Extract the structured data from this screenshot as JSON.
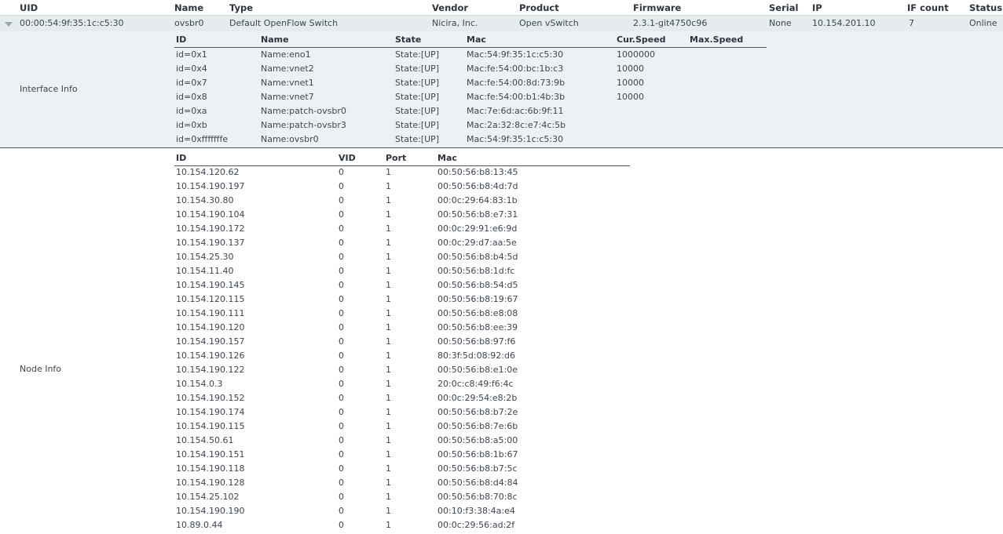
{
  "columns": {
    "uid": "UID",
    "name": "Name",
    "type": "Type",
    "vendor": "Vendor",
    "product": "Product",
    "firmware": "Firmware",
    "serial": "Serial",
    "ip": "IP",
    "ifcount": "IF count",
    "status": "Status"
  },
  "device": {
    "uid": "00:00:54:9f:35:1c:c5:30",
    "name": "ovsbr0",
    "type": "Default OpenFlow Switch",
    "vendor": "Nicira, Inc.",
    "product": "Open vSwitch",
    "firmware": "2.3.1-git4750c96",
    "serial": "None",
    "ip": "10.154.201.10",
    "ifcount": "7",
    "status": "Online"
  },
  "interface_info": {
    "label": "Interface Info",
    "headers": {
      "id": "ID",
      "name": "Name",
      "state": "State",
      "mac": "Mac",
      "cur_speed": "Cur.Speed",
      "max_speed": "Max.Speed"
    },
    "rows": [
      {
        "id": "id=0x1",
        "name": "Name:eno1",
        "state": "State:[UP]",
        "mac": "Mac:54:9f:35:1c:c5:30",
        "cur_speed": "1000000",
        "max_speed": ""
      },
      {
        "id": "id=0x4",
        "name": "Name:vnet2",
        "state": "State:[UP]",
        "mac": "Mac:fe:54:00:bc:1b:c3",
        "cur_speed": "10000",
        "max_speed": ""
      },
      {
        "id": "id=0x7",
        "name": "Name:vnet1",
        "state": "State:[UP]",
        "mac": "Mac:fe:54:00:8d:73:9b",
        "cur_speed": "10000",
        "max_speed": ""
      },
      {
        "id": "id=0x8",
        "name": "Name:vnet7",
        "state": "State:[UP]",
        "mac": "Mac:fe:54:00:b1:4b:3b",
        "cur_speed": "10000",
        "max_speed": ""
      },
      {
        "id": "id=0xa",
        "name": "Name:patch-ovsbr0",
        "state": "State:[UP]",
        "mac": "Mac:7e:6d:ac:6b:9f:11",
        "cur_speed": "",
        "max_speed": ""
      },
      {
        "id": "id=0xb",
        "name": "Name:patch-ovsbr3",
        "state": "State:[UP]",
        "mac": "Mac:2a:32:8c:e7:4c:5b",
        "cur_speed": "",
        "max_speed": ""
      },
      {
        "id": "id=0xfffffffe",
        "name": "Name:ovsbr0",
        "state": "State:[UP]",
        "mac": "Mac:54:9f:35:1c:c5:30",
        "cur_speed": "",
        "max_speed": ""
      }
    ]
  },
  "node_info": {
    "label": "Node Info",
    "headers": {
      "id": "ID",
      "vid": "VID",
      "port": "Port",
      "mac": "Mac"
    },
    "rows": [
      {
        "id": "10.154.120.62",
        "vid": "0",
        "port": "1",
        "mac": "00:50:56:b8:13:45"
      },
      {
        "id": "10.154.190.197",
        "vid": "0",
        "port": "1",
        "mac": "00:50:56:b8:4d:7d"
      },
      {
        "id": "10.154.30.80",
        "vid": "0",
        "port": "1",
        "mac": "00:0c:29:64:83:1b"
      },
      {
        "id": "10.154.190.104",
        "vid": "0",
        "port": "1",
        "mac": "00:50:56:b8:e7:31"
      },
      {
        "id": "10.154.190.172",
        "vid": "0",
        "port": "1",
        "mac": "00:0c:29:91:e6:9d"
      },
      {
        "id": "10.154.190.137",
        "vid": "0",
        "port": "1",
        "mac": "00:0c:29:d7:aa:5e"
      },
      {
        "id": "10.154.25.30",
        "vid": "0",
        "port": "1",
        "mac": "00:50:56:b8:b4:5d"
      },
      {
        "id": "10.154.11.40",
        "vid": "0",
        "port": "1",
        "mac": "00:50:56:b8:1d:fc"
      },
      {
        "id": "10.154.190.145",
        "vid": "0",
        "port": "1",
        "mac": "00:50:56:b8:54:d5"
      },
      {
        "id": "10.154.120.115",
        "vid": "0",
        "port": "1",
        "mac": "00:50:56:b8:19:67"
      },
      {
        "id": "10.154.190.111",
        "vid": "0",
        "port": "1",
        "mac": "00:50:56:b8:e8:08"
      },
      {
        "id": "10.154.190.120",
        "vid": "0",
        "port": "1",
        "mac": "00:50:56:b8:ee:39"
      },
      {
        "id": "10.154.190.157",
        "vid": "0",
        "port": "1",
        "mac": "00:50:56:b8:97:f6"
      },
      {
        "id": "10.154.190.126",
        "vid": "0",
        "port": "1",
        "mac": "80:3f:5d:08:92:d6"
      },
      {
        "id": "10.154.190.122",
        "vid": "0",
        "port": "1",
        "mac": "00:50:56:b8:e1:0e"
      },
      {
        "id": "10.154.0.3",
        "vid": "0",
        "port": "1",
        "mac": "20:0c:c8:49:f6:4c"
      },
      {
        "id": "10.154.190.152",
        "vid": "0",
        "port": "1",
        "mac": "00:0c:29:54:e8:2b"
      },
      {
        "id": "10.154.190.174",
        "vid": "0",
        "port": "1",
        "mac": "00:50:56:b8:b7:2e"
      },
      {
        "id": "10.154.190.115",
        "vid": "0",
        "port": "1",
        "mac": "00:50:56:b8:7e:6b"
      },
      {
        "id": "10.154.50.61",
        "vid": "0",
        "port": "1",
        "mac": "00:50:56:b8:a5:00"
      },
      {
        "id": "10.154.190.151",
        "vid": "0",
        "port": "1",
        "mac": "00:50:56:b8:1b:67"
      },
      {
        "id": "10.154.190.118",
        "vid": "0",
        "port": "1",
        "mac": "00:50:56:b8:b7:5c"
      },
      {
        "id": "10.154.190.128",
        "vid": "0",
        "port": "1",
        "mac": "00:50:56:b8:d4:84"
      },
      {
        "id": "10.154.25.102",
        "vid": "0",
        "port": "1",
        "mac": "00:50:56:b8:70:8c"
      },
      {
        "id": "10.154.190.190",
        "vid": "0",
        "port": "1",
        "mac": "00:10:f3:38:4a:e4"
      },
      {
        "id": "10.89.0.44",
        "vid": "0",
        "port": "1",
        "mac": "00:0c:29:56:ad:2f"
      }
    ]
  }
}
